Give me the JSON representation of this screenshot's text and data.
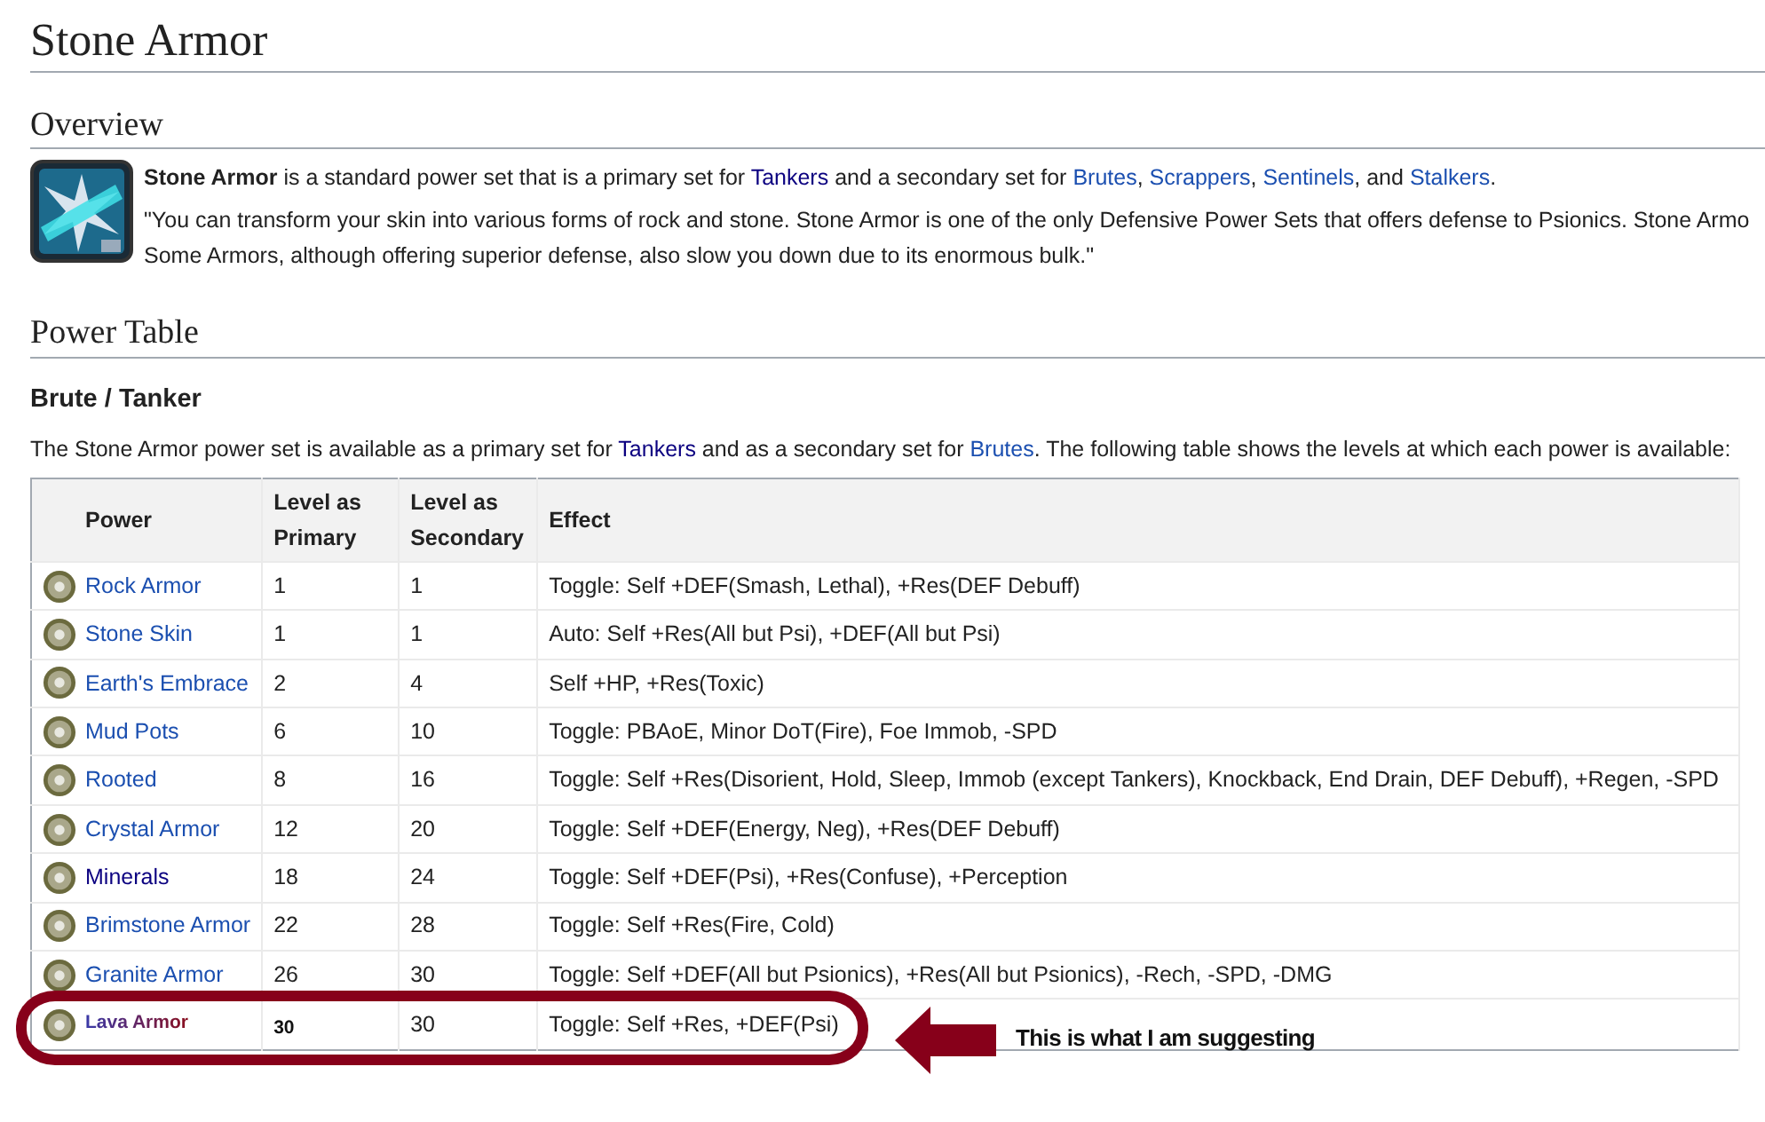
{
  "title": "Stone Armor",
  "overview": {
    "heading": "Overview",
    "intro": [
      {
        "text": "**Stone Armor** is a standard power set that is a primary set for "
      },
      {
        "link": "Tankers",
        "visited": true
      },
      {
        "text": " and a secondary set for "
      },
      {
        "link": "Brutes",
        "visited": false
      },
      {
        "text": ", "
      },
      {
        "link": "Scrappers",
        "visited": false
      },
      {
        "text": ", "
      },
      {
        "link": "Sentinels",
        "visited": false
      },
      {
        "text": ", and "
      },
      {
        "link": "Stalkers",
        "visited": false
      },
      {
        "text": "."
      }
    ],
    "quote": [
      "\"You can transform your skin into various forms of rock and stone. Stone Armor is one of the only Defensive Power Sets that offers defense to Psionics. Stone Armo",
      "Some Armors, although offering superior defense, also slow you down due to its enormous bulk.\""
    ]
  },
  "power_table": {
    "heading": "Power Table",
    "subheading": "Brute / Tanker",
    "description": [
      {
        "text": "The Stone Armor power set is available as a primary set for "
      },
      {
        "link": "Tankers",
        "visited": true
      },
      {
        "text": " and as a secondary set for "
      },
      {
        "link": "Brutes",
        "visited": false
      },
      {
        "text": ". The following table shows the levels at which each power is available:"
      }
    ],
    "columns": [
      "Power",
      "Level as Primary",
      "Level as Secondary",
      "Effect"
    ],
    "rows": [
      {
        "kind": "normal",
        "power": "Rock Armor",
        "visited": false,
        "primary": "1",
        "secondary": "1",
        "effect": "Toggle: Self +DEF(Smash, Lethal), +Res(DEF Debuff)"
      },
      {
        "kind": "normal",
        "power": "Stone Skin",
        "visited": false,
        "primary": "1",
        "secondary": "1",
        "effect": "Auto: Self +Res(All but Psi), +DEF(All but Psi)"
      },
      {
        "kind": "normal",
        "power": "Earth's Embrace",
        "visited": false,
        "primary": "2",
        "secondary": "4",
        "effect": "Self +HP, +Res(Toxic)"
      },
      {
        "kind": "normal",
        "power": "Mud Pots",
        "visited": false,
        "primary": "6",
        "secondary": "10",
        "effect": "Toggle: PBAoE, Minor DoT(Fire), Foe Immob, -SPD"
      },
      {
        "kind": "normal",
        "power": "Rooted",
        "visited": false,
        "primary": "8",
        "secondary": "16",
        "effect": "Toggle: Self +Res(Disorient, Hold, Sleep, Immob (except Tankers), Knockback, End Drain, DEF Debuff), +Regen, -SPD"
      },
      {
        "kind": "normal",
        "power": "Crystal Armor",
        "visited": false,
        "primary": "12",
        "secondary": "20",
        "effect": "Toggle: Self +DEF(Energy, Neg), +Res(DEF Debuff)"
      },
      {
        "kind": "normal",
        "power": "Minerals",
        "visited": true,
        "primary": "18",
        "secondary": "24",
        "effect": "Toggle: Self +DEF(Psi), +Res(Confuse), +Perception"
      },
      {
        "kind": "normal",
        "power": "Brimstone Armor",
        "visited": false,
        "primary": "22",
        "secondary": "28",
        "effect": "Toggle: Self +Res(Fire, Cold)"
      },
      {
        "kind": "normal",
        "power": "Granite Armor",
        "visited": false,
        "primary": "26",
        "secondary": "30",
        "effect": "Toggle: Self +DEF(All but Psionics), +Res(All but Psionics), -Rech, -SPD, -DMG"
      },
      {
        "kind": "suggested",
        "power": "Lava Armor",
        "primary": "30",
        "secondary": "30",
        "effect": "Toggle: Self +Res, +DEF(Psi)"
      }
    ]
  },
  "annotation": {
    "text": "This is what I am suggesting"
  }
}
